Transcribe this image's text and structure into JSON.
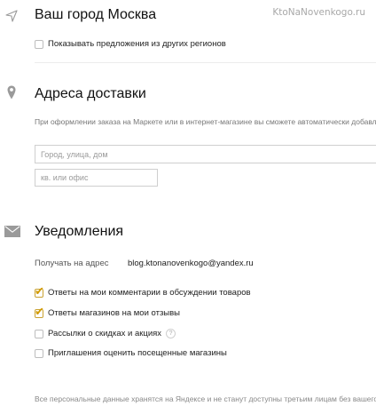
{
  "watermark": "KtoNaNovenkogo.ru",
  "city": {
    "title": "Ваш город Москва",
    "show_other_regions_label": "Показывать предложения из других регионов",
    "show_other_regions_checked": false
  },
  "delivery": {
    "title": "Адреса доставки",
    "description": "При оформлении заказа на Маркете или в интернет-магазине вы сможете автоматически добавлять нужн",
    "street_placeholder": "Город, улица, дом",
    "apartment_placeholder": "кв. или офис"
  },
  "notifications": {
    "title": "Уведомления",
    "receive_label": "Получать на адрес",
    "email": "blog.ktonanovenkogo@yandex.ru",
    "options": [
      {
        "label": "Ответы на мои комментарии в обсуждении товаров",
        "checked": true
      },
      {
        "label": "Ответы магазинов на мои отзывы",
        "checked": true
      },
      {
        "label": "Рассылки о скидках и акциях",
        "checked": false,
        "help": "?"
      },
      {
        "label": "Приглашения оценить посещенные магазины",
        "checked": false
      }
    ]
  },
  "footer_note": "Все персональные данные хранятся на Яндексе и не станут доступны третьим лицам без вашего подтвер"
}
